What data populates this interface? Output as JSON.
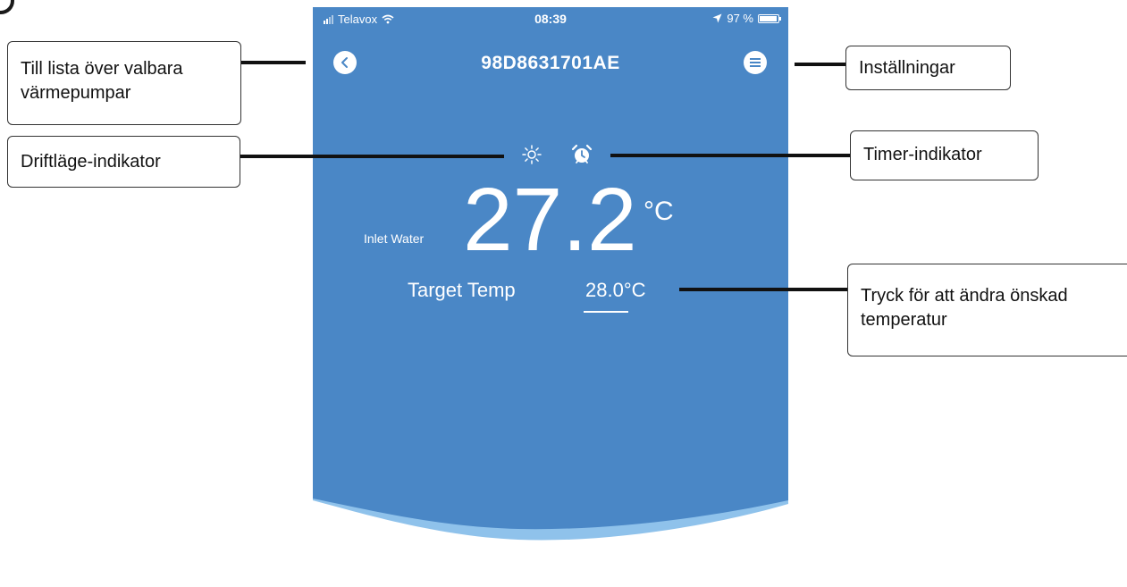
{
  "status_bar": {
    "carrier": "Telavox",
    "time": "08:39",
    "battery": "97 %",
    "battery_level": 0.97
  },
  "header": {
    "title": "98D8631701AE"
  },
  "icons": {
    "back": "chevron-left-icon",
    "menu": "menu-icon",
    "mode": "sun-icon",
    "timer": "alarm-clock-icon"
  },
  "main": {
    "inlet_label": "Inlet Water",
    "temperature": "27.2",
    "temperature_unit": "°C",
    "target_label": "Target Temp",
    "target_value": "28.0°C"
  },
  "callouts": {
    "back": {
      "line1": "Till lista över valbara",
      "line2": "värmepumpar"
    },
    "mode": "Driftläge-indikator",
    "settings": "Inställningar",
    "timer": "Timer-indikator",
    "target": {
      "line1": "Tryck för att ändra önskad",
      "line2": "temperatur"
    }
  },
  "colors": {
    "screen_blue": "#4a87c6",
    "wave_light": "#8fc2eb",
    "text": "#ffffff"
  }
}
